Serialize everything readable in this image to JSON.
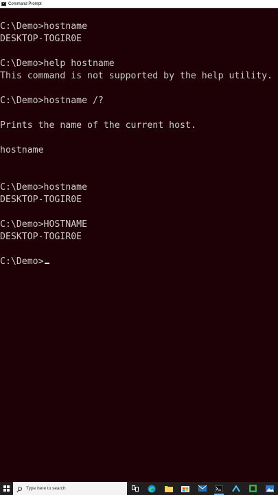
{
  "window": {
    "title": "Command Prompt",
    "icon": "cmd-icon"
  },
  "console": {
    "lines": [
      "C:\\Demo>hostname",
      "DESKTOP-TOGIR0E",
      "",
      "C:\\Demo>help hostname",
      "This command is not supported by the help utility.",
      "",
      "C:\\Demo>hostname /?",
      "",
      "Prints the name of the current host.",
      "",
      "hostname",
      "",
      "",
      "C:\\Demo>hostname",
      "DESKTOP-TOGIR0E",
      "",
      "C:\\Demo>HOSTNAME",
      "DESKTOP-TOGIR0E",
      ""
    ],
    "prompt": "C:\\Demo>"
  },
  "taskbar": {
    "search_placeholder": "Type here to search",
    "icons": [
      "windows-start-icon",
      "task-view-icon",
      "edge-icon",
      "file-explorer-icon",
      "store-icon",
      "mail-icon",
      "terminal-icon",
      "arc-icon",
      "green-app-icon",
      "photos-icon"
    ],
    "colors": {
      "taskbar": "#202020",
      "console_bg": "#1e0007",
      "console_text": "#cccccc",
      "accent": "#7db3e8"
    }
  }
}
